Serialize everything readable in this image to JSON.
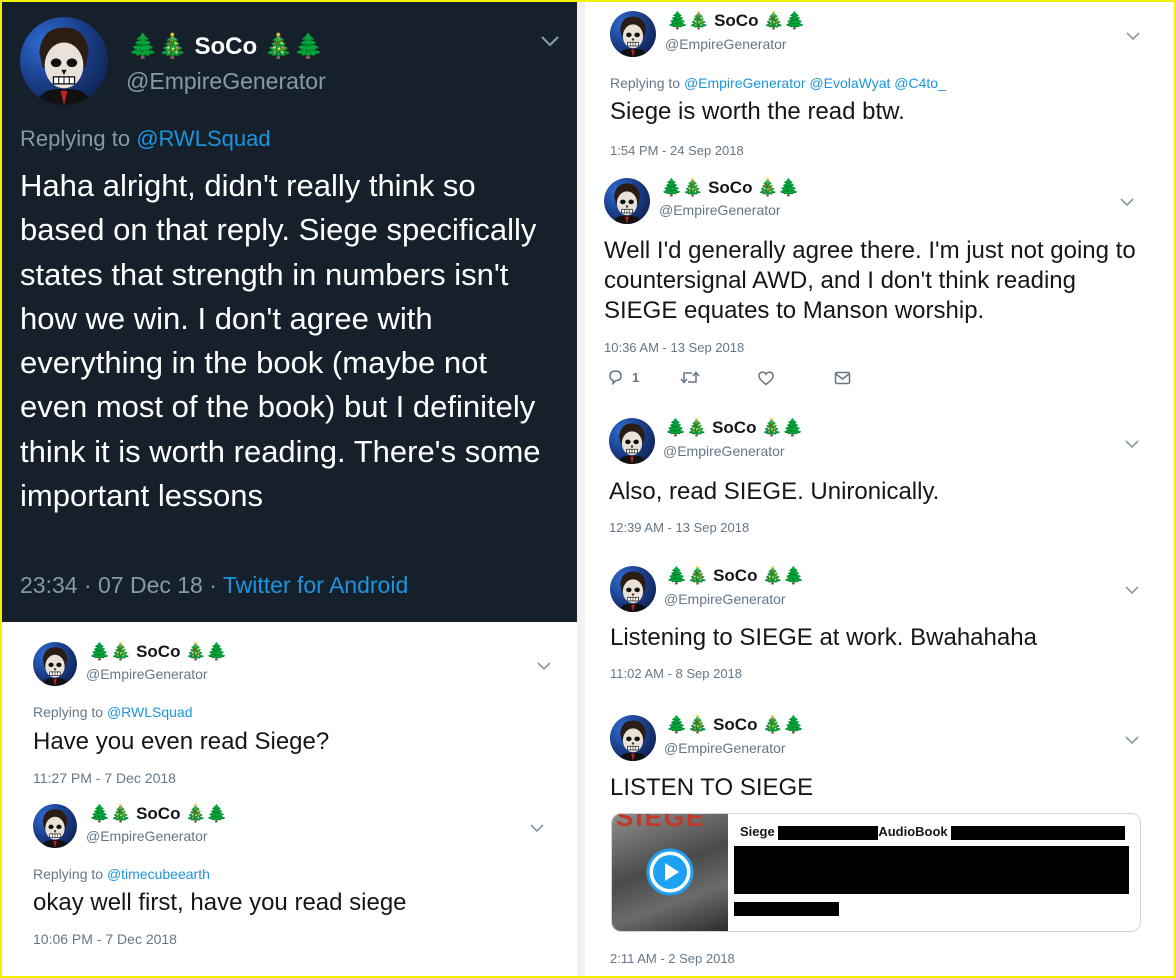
{
  "user": {
    "name": "SoCo",
    "emoji_left": "🌲🎄",
    "emoji_right": "🎄🌲",
    "handle": "@EmpireGenerator"
  },
  "main_tweet": {
    "reply_prefix": "Replying to ",
    "reply_to": "@RWLSquad",
    "text": "Haha alright, didn't really think so based on that reply. Siege specifically states that strength in numbers isn't how we win. I don't agree with everything in the book (maybe not even most of the book) but I definitely think it is worth reading. There's some important lessons",
    "timestamp": "23:34 · 07 Dec 18 · ",
    "source": "Twitter for Android"
  },
  "tweets_left": [
    {
      "reply_prefix": "Replying to ",
      "reply_to": "@RWLSquad",
      "text": "Have you even read Siege?",
      "time": "11:27 PM - 7 Dec 2018"
    },
    {
      "reply_prefix": "Replying to ",
      "reply_to": "@timecubeearth",
      "text": "okay well first, have you read siege",
      "time": "10:06 PM - 7 Dec 2018"
    }
  ],
  "tweets_right": [
    {
      "reply_prefix": "Replying to ",
      "reply_to": "@EmpireGenerator @EvolaWyat @C4to_",
      "text": "Siege is worth the read btw.",
      "time": "1:54 PM - 24 Sep 2018"
    },
    {
      "text": "Well I'd generally agree there. I'm just not going to countersignal AWD, and I don't think reading SIEGE equates to Manson worship.",
      "time": "10:36 AM - 13 Sep 2018",
      "reply_count": "1"
    },
    {
      "text": "Also, read SIEGE. Unironically.",
      "time": "12:39 AM - 13 Sep 2018"
    },
    {
      "text": "Listening to SIEGE at work. Bwahahaha",
      "time": "11:02 AM - 8 Sep 2018"
    },
    {
      "text": "LISTEN TO SIEGE",
      "time": "2:11 AM - 2 Sep 2018",
      "card": {
        "title_start": "Siege",
        "title_mid": "AudioBook",
        "thumb_text": "SIEGE"
      }
    }
  ],
  "icons": [
    "chevron-down-icon",
    "reply-icon",
    "retweet-icon",
    "like-icon",
    "dm-icon",
    "play-icon",
    "skull-avatar"
  ],
  "colors": {
    "dark_bg": "#15202b",
    "link": "#1b95e0",
    "frame": "#f2f200"
  }
}
